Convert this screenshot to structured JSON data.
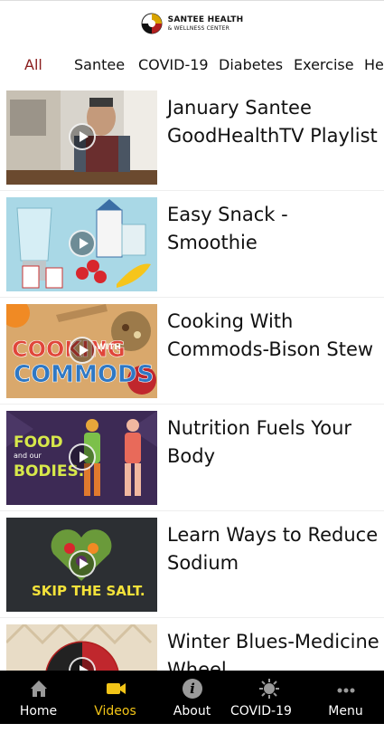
{
  "header": {
    "logo_line1": "SANTEE HEALTH",
    "logo_line2": "& WELLNESS CENTER"
  },
  "tabs": [
    {
      "label": "All",
      "active": true
    },
    {
      "label": "Santee"
    },
    {
      "label": "COVID-19"
    },
    {
      "label": "Diabetes"
    },
    {
      "label": "Exercise"
    },
    {
      "label": "He"
    }
  ],
  "videos": [
    {
      "title": "January Santee GoodHealthTV Playlist",
      "thumb_text": ""
    },
    {
      "title": "Easy Snack - Smoothie",
      "thumb_text": ""
    },
    {
      "title": "Cooking With Commods-Bison Stew",
      "thumb_text_1": "COOKING",
      "thumb_text_2": "WITH",
      "thumb_text_3": "COMMODS"
    },
    {
      "title": "Nutrition Fuels Your Body",
      "thumb_text_1": "FOOD",
      "thumb_text_2": "and our",
      "thumb_text_3": "BODIES."
    },
    {
      "title": "Learn Ways to Reduce Sodium",
      "thumb_text_1": "SKIP THE SALT."
    },
    {
      "title": "Winter Blues-Medicine Wheel"
    }
  ],
  "bottom_nav": [
    {
      "label": "Home",
      "icon": "home-icon"
    },
    {
      "label": "Videos",
      "icon": "video-camera-icon",
      "active": true
    },
    {
      "label": "About",
      "icon": "info-icon"
    },
    {
      "label": "COVID-19 ...",
      "icon": "virus-icon"
    },
    {
      "label": "Menu",
      "icon": "more-dots-icon"
    }
  ],
  "colors": {
    "active_tab": "#8a1c1c",
    "active_nav": "#f2c417",
    "nav_background": "#000000"
  }
}
